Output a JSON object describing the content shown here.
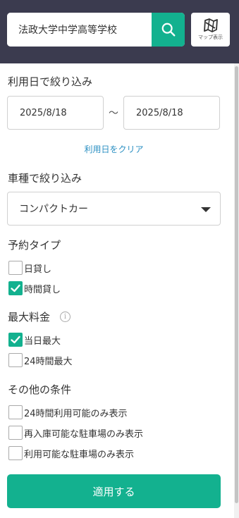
{
  "search": {
    "value": "法政大学中学高等学校",
    "placeholder": ""
  },
  "map_button": {
    "label": "マップ表示"
  },
  "date_filter": {
    "heading": "利用日で絞り込み",
    "start": "2025/8/18",
    "separator": "〜",
    "end": "2025/8/18",
    "clear_label": "利用日をクリア"
  },
  "car_filter": {
    "heading": "車種で絞り込み",
    "selected": "コンパクトカー"
  },
  "reservation_type": {
    "heading": "予約タイプ",
    "options": [
      {
        "label": "日貸し",
        "checked": false
      },
      {
        "label": "時間貸し",
        "checked": true
      }
    ]
  },
  "max_fee": {
    "heading": "最大料金",
    "info_icon": "info-icon",
    "options": [
      {
        "label": "当日最大",
        "checked": true
      },
      {
        "label": "24時間最大",
        "checked": false
      }
    ]
  },
  "other_conditions": {
    "heading": "その他の条件",
    "options": [
      {
        "label": "24時間利用可能のみ表示",
        "checked": false
      },
      {
        "label": "再入庫可能な駐車場のみ表示",
        "checked": false
      },
      {
        "label": "利用可能な駐車場のみ表示",
        "checked": false
      }
    ]
  },
  "apply_button": {
    "label": "適用する"
  },
  "colors": {
    "accent": "#13b18f",
    "header_bg": "#3b3b4f",
    "link": "#2a8fc2"
  }
}
